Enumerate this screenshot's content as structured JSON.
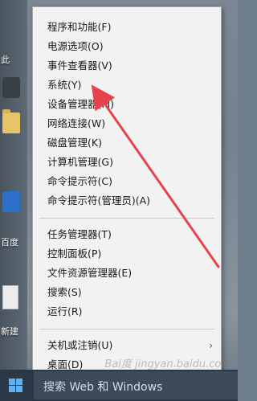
{
  "desktop": {
    "icon_labels": [
      "此",
      "百度",
      "新建"
    ]
  },
  "context_menu": {
    "items": [
      {
        "label": "程序和功能(F)"
      },
      {
        "label": "电源选项(O)"
      },
      {
        "label": "事件查看器(V)"
      },
      {
        "label": "系统(Y)"
      },
      {
        "label": "设备管理器(M)"
      },
      {
        "label": "网络连接(W)"
      },
      {
        "label": "磁盘管理(K)"
      },
      {
        "label": "计算机管理(G)"
      },
      {
        "label": "命令提示符(C)"
      },
      {
        "label": "命令提示符(管理员)(A)"
      },
      {
        "label": "任务管理器(T)"
      },
      {
        "label": "控制面板(P)"
      },
      {
        "label": "文件资源管理器(E)"
      },
      {
        "label": "搜索(S)"
      },
      {
        "label": "运行(R)"
      },
      {
        "label": "关机或注销(U)"
      },
      {
        "label": "桌面(D)"
      }
    ],
    "submenu_arrow_glyph": "›"
  },
  "taskbar": {
    "search_text": "搜索 Web 和 Windows",
    "start_icon": "windows-logo-icon"
  },
  "watermark": {
    "text": "Bai度 jingyan.baidu.com"
  },
  "annotation": {
    "arrow_color": "#e8434d"
  }
}
